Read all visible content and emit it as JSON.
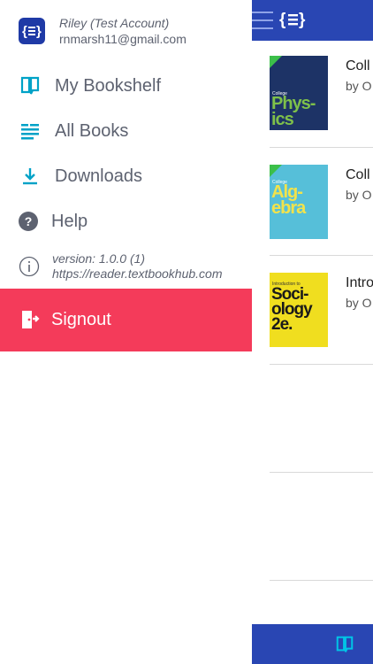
{
  "profile": {
    "name": "Riley (Test Account)",
    "email": "rnmarsh11@gmail.com",
    "logo_icon": "braces-logo-icon"
  },
  "menu": {
    "bookshelf": "My Bookshelf",
    "all_books": "All Books",
    "downloads": "Downloads",
    "help": "Help"
  },
  "version": {
    "line1": "version: 1.0.0 (1)",
    "line2": "https://reader.textbookhub.com"
  },
  "signout": {
    "label": "Signout"
  },
  "books": [
    {
      "title": "Coll",
      "by": "by O",
      "cover_text": "Phys-\nics",
      "cover_top": "College",
      "downloaded": true
    },
    {
      "title": "Coll",
      "by": "by O",
      "cover_text": "Alg-\nebra",
      "cover_top": "College",
      "downloaded": true
    },
    {
      "title": "Intro",
      "by": "by O",
      "cover_text": "Soci-\nology\n2e.",
      "cover_top": "Introduction to",
      "downloaded": false
    }
  ],
  "colors": {
    "brand": "#2946b3",
    "accent": "#00a2c7",
    "signout": "#f43b5a"
  }
}
